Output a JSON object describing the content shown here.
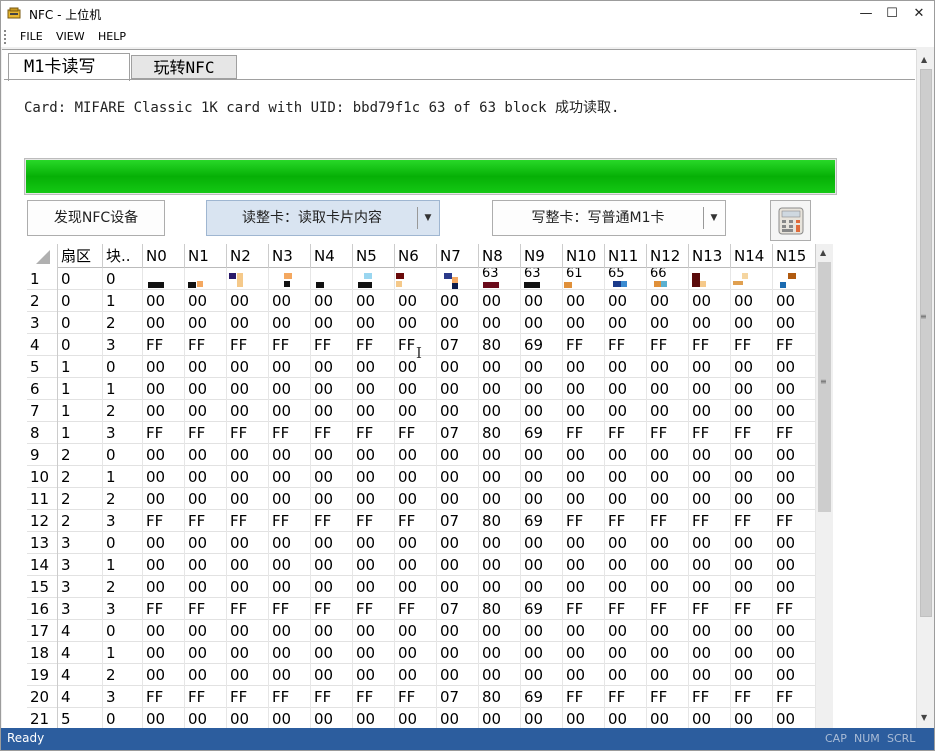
{
  "window": {
    "title": "NFC - 上位机",
    "minimize": "—",
    "maximize": "☐",
    "close": "✕"
  },
  "menu": [
    "FILE",
    "VIEW",
    "HELP"
  ],
  "tabs": {
    "active": "M1卡读写",
    "other": "玩转NFC"
  },
  "status_line": "Card: MIFARE Classic 1K card with UID: bbd79f1c 63 of 63 block 成功读取.",
  "progress_fraction": 1.0,
  "progress_color": "#0ab80a",
  "buttons": {
    "find": "发现NFC设备",
    "read": "读整卡：读取卡片内容",
    "write": "写整卡：写普通M1卡",
    "calculator": "calculator-icon"
  },
  "grid": {
    "headers": [
      "扇区",
      "块..",
      "N0",
      "N1",
      "N2",
      "N3",
      "N4",
      "N5",
      "N6",
      "N7",
      "N8",
      "N9",
      "N10",
      "N11",
      "N12",
      "N13",
      "N14",
      "N15"
    ],
    "first_row_partial": [
      "1",
      "0",
      "0",
      "",
      "",
      "",
      "",
      "",
      "",
      "",
      "",
      "63",
      "63",
      "61",
      "65",
      "66",
      "",
      "",
      ""
    ],
    "rows": [
      [
        "2",
        "0",
        "1",
        "00",
        "00",
        "00",
        "00",
        "00",
        "00",
        "00",
        "00",
        "00",
        "00",
        "00",
        "00",
        "00",
        "00",
        "00",
        "00"
      ],
      [
        "3",
        "0",
        "2",
        "00",
        "00",
        "00",
        "00",
        "00",
        "00",
        "00",
        "00",
        "00",
        "00",
        "00",
        "00",
        "00",
        "00",
        "00",
        "00"
      ],
      [
        "4",
        "0",
        "3",
        "FF",
        "FF",
        "FF",
        "FF",
        "FF",
        "FF",
        "FF",
        "07",
        "80",
        "69",
        "FF",
        "FF",
        "FF",
        "FF",
        "FF",
        "FF"
      ],
      [
        "5",
        "1",
        "0",
        "00",
        "00",
        "00",
        "00",
        "00",
        "00",
        "00",
        "00",
        "00",
        "00",
        "00",
        "00",
        "00",
        "00",
        "00",
        "00"
      ],
      [
        "6",
        "1",
        "1",
        "00",
        "00",
        "00",
        "00",
        "00",
        "00",
        "00",
        "00",
        "00",
        "00",
        "00",
        "00",
        "00",
        "00",
        "00",
        "00"
      ],
      [
        "7",
        "1",
        "2",
        "00",
        "00",
        "00",
        "00",
        "00",
        "00",
        "00",
        "00",
        "00",
        "00",
        "00",
        "00",
        "00",
        "00",
        "00",
        "00"
      ],
      [
        "8",
        "1",
        "3",
        "FF",
        "FF",
        "FF",
        "FF",
        "FF",
        "FF",
        "FF",
        "07",
        "80",
        "69",
        "FF",
        "FF",
        "FF",
        "FF",
        "FF",
        "FF"
      ],
      [
        "9",
        "2",
        "0",
        "00",
        "00",
        "00",
        "00",
        "00",
        "00",
        "00",
        "00",
        "00",
        "00",
        "00",
        "00",
        "00",
        "00",
        "00",
        "00"
      ],
      [
        "10",
        "2",
        "1",
        "00",
        "00",
        "00",
        "00",
        "00",
        "00",
        "00",
        "00",
        "00",
        "00",
        "00",
        "00",
        "00",
        "00",
        "00",
        "00"
      ],
      [
        "11",
        "2",
        "2",
        "00",
        "00",
        "00",
        "00",
        "00",
        "00",
        "00",
        "00",
        "00",
        "00",
        "00",
        "00",
        "00",
        "00",
        "00",
        "00"
      ],
      [
        "12",
        "2",
        "3",
        "FF",
        "FF",
        "FF",
        "FF",
        "FF",
        "FF",
        "FF",
        "07",
        "80",
        "69",
        "FF",
        "FF",
        "FF",
        "FF",
        "FF",
        "FF"
      ],
      [
        "13",
        "3",
        "0",
        "00",
        "00",
        "00",
        "00",
        "00",
        "00",
        "00",
        "00",
        "00",
        "00",
        "00",
        "00",
        "00",
        "00",
        "00",
        "00"
      ],
      [
        "14",
        "3",
        "1",
        "00",
        "00",
        "00",
        "00",
        "00",
        "00",
        "00",
        "00",
        "00",
        "00",
        "00",
        "00",
        "00",
        "00",
        "00",
        "00"
      ],
      [
        "15",
        "3",
        "2",
        "00",
        "00",
        "00",
        "00",
        "00",
        "00",
        "00",
        "00",
        "00",
        "00",
        "00",
        "00",
        "00",
        "00",
        "00",
        "00"
      ],
      [
        "16",
        "3",
        "3",
        "FF",
        "FF",
        "FF",
        "FF",
        "FF",
        "FF",
        "FF",
        "07",
        "80",
        "69",
        "FF",
        "FF",
        "FF",
        "FF",
        "FF",
        "FF"
      ],
      [
        "17",
        "4",
        "0",
        "00",
        "00",
        "00",
        "00",
        "00",
        "00",
        "00",
        "00",
        "00",
        "00",
        "00",
        "00",
        "00",
        "00",
        "00",
        "00"
      ],
      [
        "18",
        "4",
        "1",
        "00",
        "00",
        "00",
        "00",
        "00",
        "00",
        "00",
        "00",
        "00",
        "00",
        "00",
        "00",
        "00",
        "00",
        "00",
        "00"
      ],
      [
        "19",
        "4",
        "2",
        "00",
        "00",
        "00",
        "00",
        "00",
        "00",
        "00",
        "00",
        "00",
        "00",
        "00",
        "00",
        "00",
        "00",
        "00",
        "00"
      ],
      [
        "20",
        "4",
        "3",
        "FF",
        "FF",
        "FF",
        "FF",
        "FF",
        "FF",
        "FF",
        "07",
        "80",
        "69",
        "FF",
        "FF",
        "FF",
        "FF",
        "FF",
        "FF"
      ],
      [
        "21",
        "5",
        "0",
        "00",
        "00",
        "00",
        "00",
        "00",
        "00",
        "00",
        "00",
        "00",
        "00",
        "00",
        "00",
        "00",
        "00",
        "00",
        "00"
      ]
    ]
  },
  "statusbar": {
    "text": "Ready",
    "indicators": [
      "CAP",
      "NUM",
      "SCRL"
    ]
  },
  "colors": {
    "statusbar_bg": "#2c5d9e",
    "read_button_bg": "#d9e4f1"
  }
}
